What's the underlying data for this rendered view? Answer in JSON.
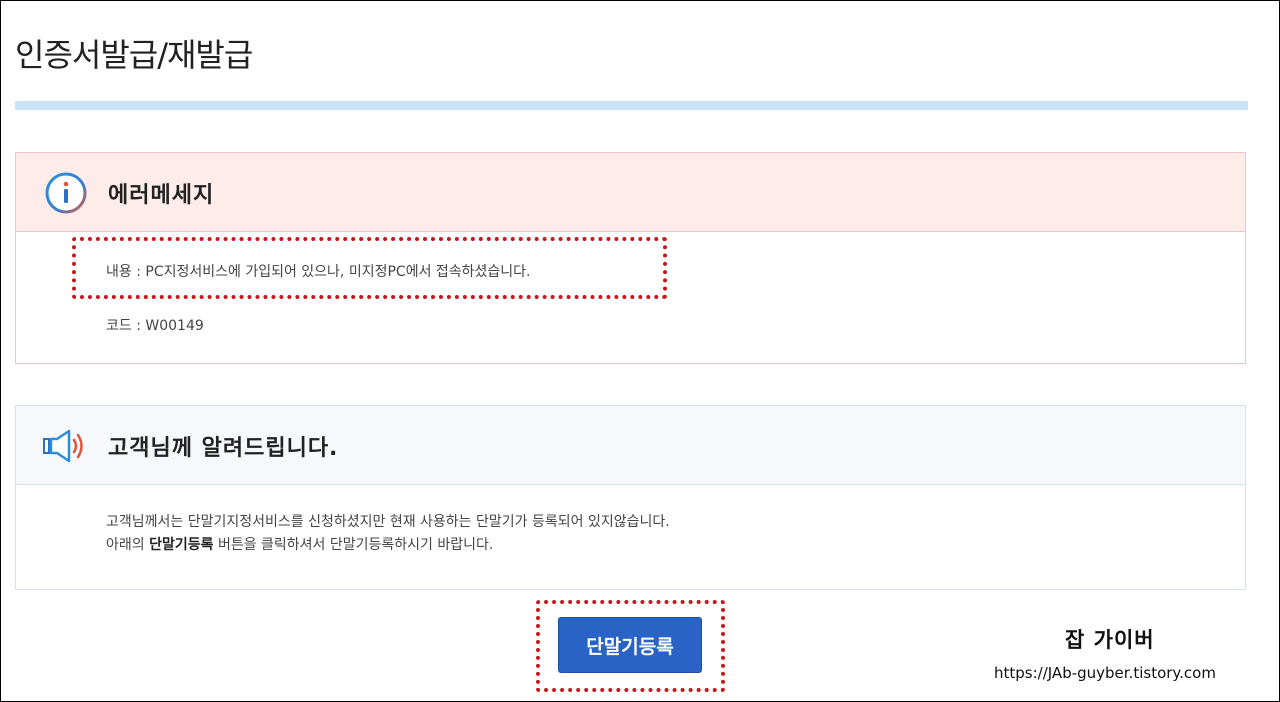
{
  "page": {
    "title": "인증서발급/재발급"
  },
  "error": {
    "title": "에러메세지",
    "content_line": "내용 : PC지정서비스에 가입되어 있으나, 미지정PC에서 접속하셨습니다.",
    "code_line": "코드 : W00149"
  },
  "notice": {
    "title": "고객님께 알려드립니다.",
    "line1": "고객님께서는 단말기지정서비스를 신청하셨지만 현재 사용하는 단말기가 등록되어 있지않습니다.",
    "line2_prefix": "아래의 ",
    "line2_bold": "단말기등록",
    "line2_suffix": " 버튼을 클릭하셔서 단말기등록하시기 바랍니다."
  },
  "actions": {
    "register_label": "단말기등록"
  },
  "watermark": {
    "name": "잡 가이버",
    "url": "https://JAb-guyber.tistory.com"
  },
  "colors": {
    "accent_blue": "#2a63c6",
    "highlight_red": "#c8161d",
    "error_bg": "#fdecea",
    "notice_bg": "#f6f8fb",
    "title_rule": "#c8e4f6"
  },
  "icons": {
    "error": "info-circle-icon",
    "notice": "speaker-icon"
  }
}
